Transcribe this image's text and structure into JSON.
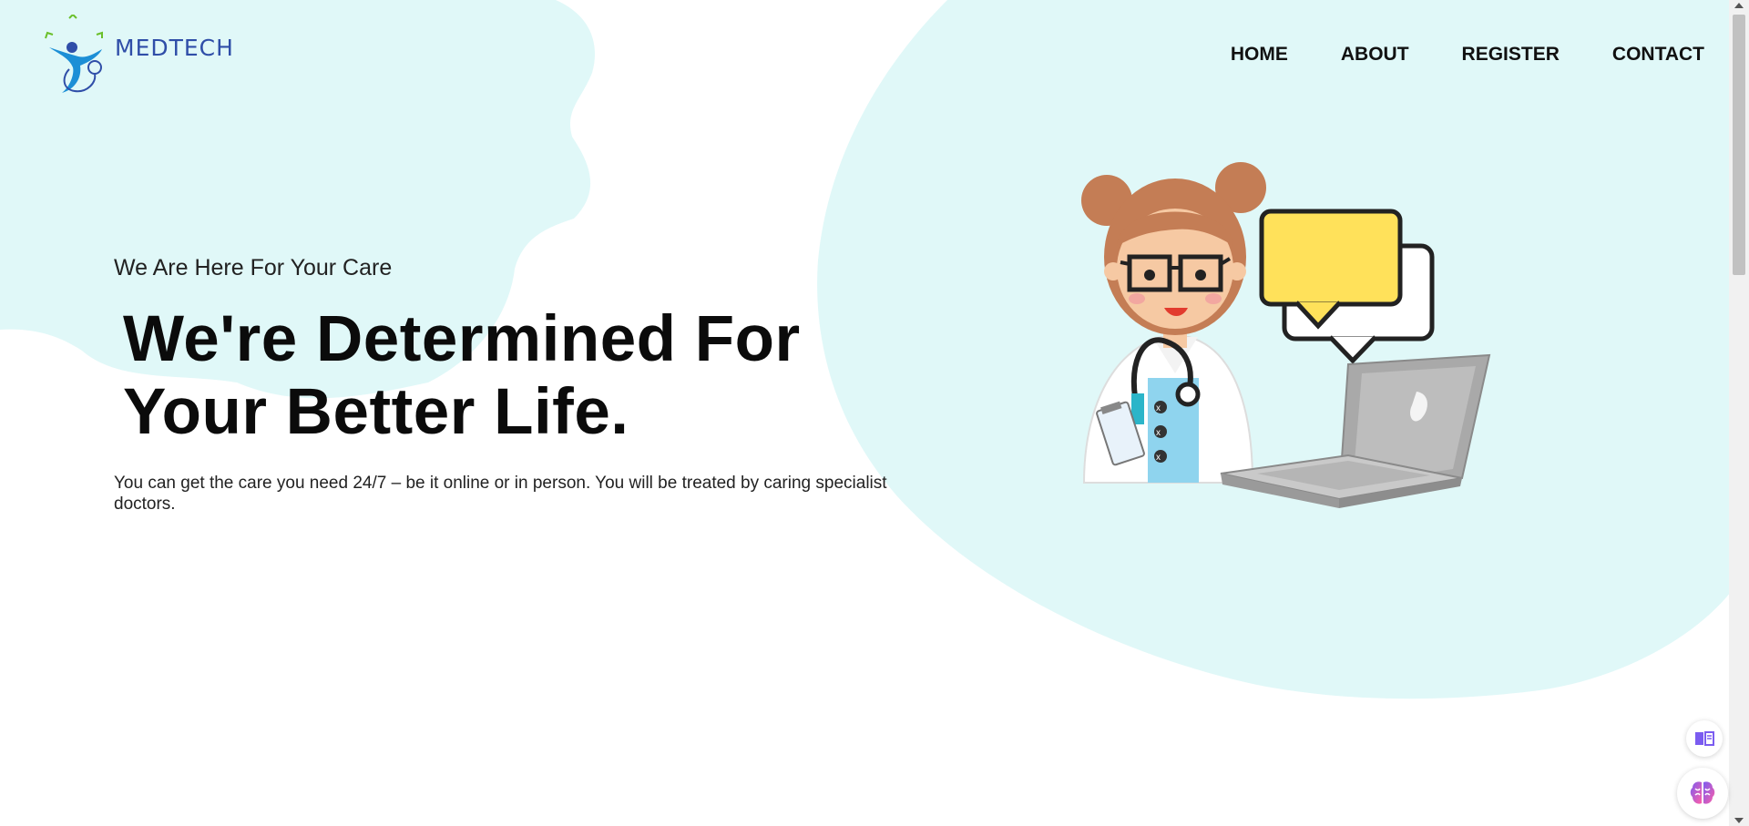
{
  "brand": {
    "name": "MEDTECH"
  },
  "nav": {
    "items": [
      {
        "label": "HOME"
      },
      {
        "label": "ABOUT"
      },
      {
        "label": "REGISTER"
      },
      {
        "label": "CONTACT"
      }
    ]
  },
  "hero": {
    "tagline": "We Are Here For Your Care",
    "headline": "We're Determined For Your Better Life.",
    "description": "You can get the care you need 24/7 – be it online or in person. You will be treated by caring specialist doctors."
  },
  "colors": {
    "blob": "#e0f8f8",
    "brand_blue": "#2f4ea8",
    "text": "#111111"
  },
  "icons": {
    "logo": "medtech-figure-logo",
    "floating_1": "book-icon",
    "floating_2": "brain-icon"
  }
}
